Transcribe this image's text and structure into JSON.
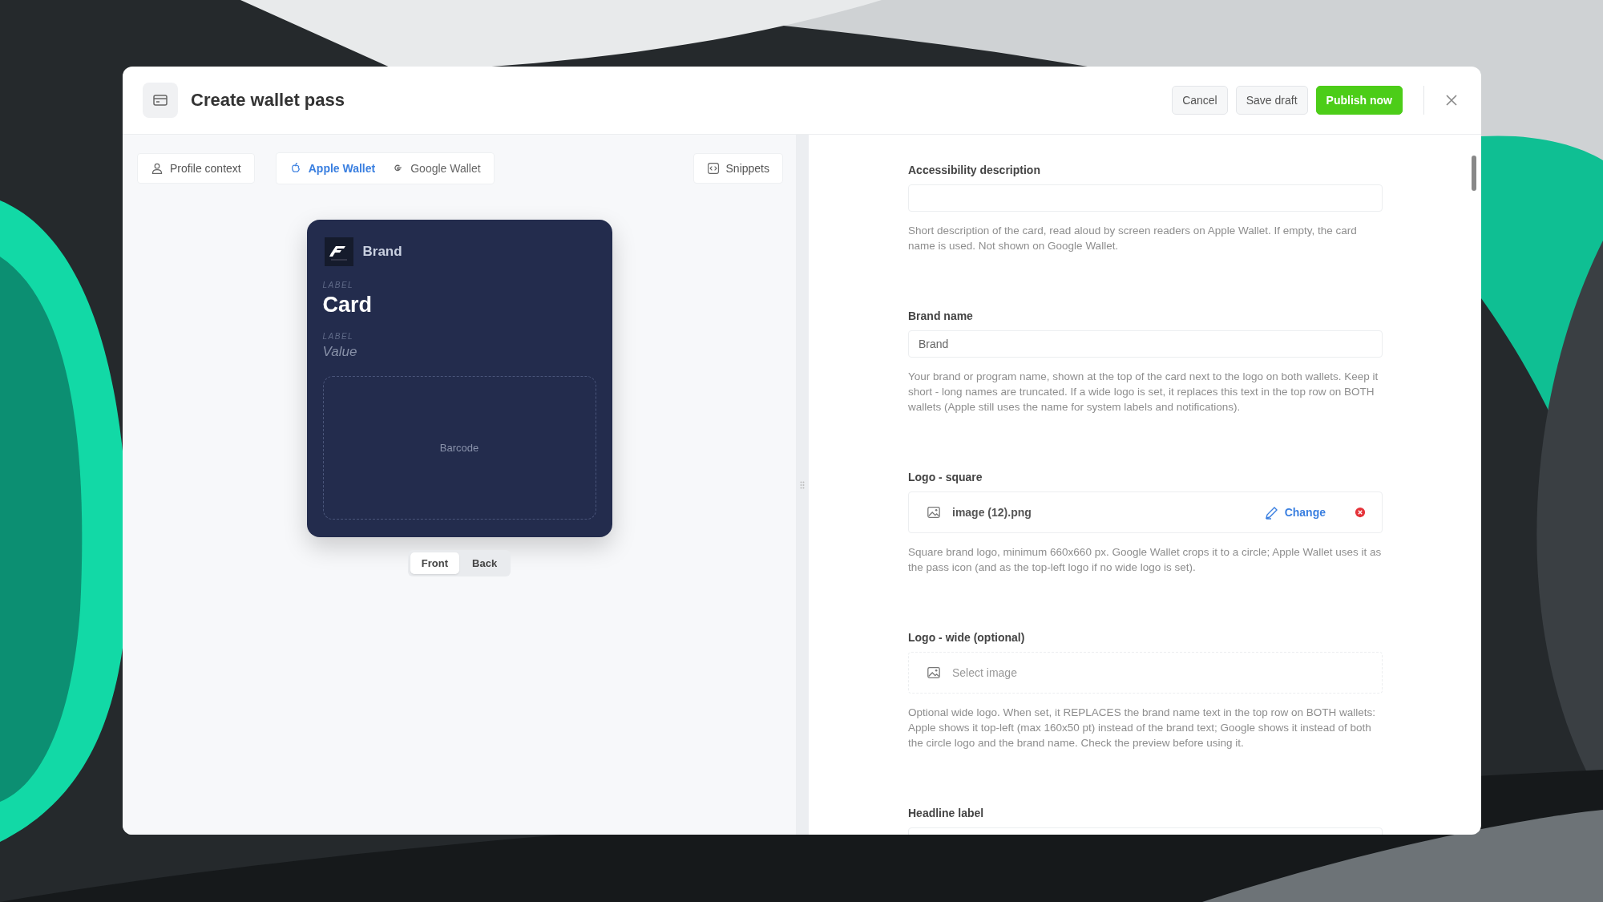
{
  "window": {
    "title": "Create wallet pass"
  },
  "header_buttons": [
    {
      "label": "Cancel",
      "kind": "secondary"
    },
    {
      "label": "Save draft",
      "kind": "secondary"
    },
    {
      "label": "Publish now",
      "kind": "primary"
    }
  ],
  "profile_button": {
    "label": "Profile context"
  },
  "wallet_tabs": [
    {
      "label": "Apple Wallet",
      "kind": "apple",
      "selected": true
    },
    {
      "label": "Google Wallet",
      "kind": "google",
      "selected": false
    }
  ],
  "snippets_button": {
    "label": "Snippets"
  },
  "card": {
    "brand": "Brand",
    "primary_label": "LABEL",
    "primary_value": "Card",
    "secondary_label": "LABEL",
    "secondary_value": "Value",
    "barcode": "Barcode"
  },
  "side_toggle": [
    {
      "label": "Front",
      "selected": true
    },
    {
      "label": "Back",
      "selected": false
    }
  ],
  "form_fields": [
    {
      "kind": "text",
      "label": "Accessibility description",
      "help": "Short description of the card, read aloud by screen readers on Apple Wallet. If empty, the card name is used. Not shown on Google Wallet."
    },
    {
      "kind": "text",
      "label": "Brand name",
      "value": "Brand",
      "help": "Your brand or program name, shown at the top of the card next to the logo on both wallets. Keep it short - long names are truncated. If a wide logo is set, it replaces this text in the top row on BOTH wallets (Apple still uses the name for system labels and notifications)."
    },
    {
      "kind": "file",
      "label": "Logo - square",
      "file_name": "image (12).png",
      "change_label": "Change",
      "help": "Square brand logo, minimum 660x660 px. Google Wallet crops it to a circle; Apple Wallet uses it as the pass icon (and as the top-left logo if no wide logo is set)."
    },
    {
      "kind": "file",
      "label": "Logo - wide (optional)",
      "placeholder": "Select image",
      "help": "Optional wide logo. When set, it REPLACES the brand name text in the top row on BOTH wallets: Apple shows it top-left (max 160x50 pt) instead of the brand text; Google shows it instead of both the circle logo and the brand name. Check the preview before using it."
    },
    {
      "kind": "text",
      "label": "Headline label"
    }
  ]
}
